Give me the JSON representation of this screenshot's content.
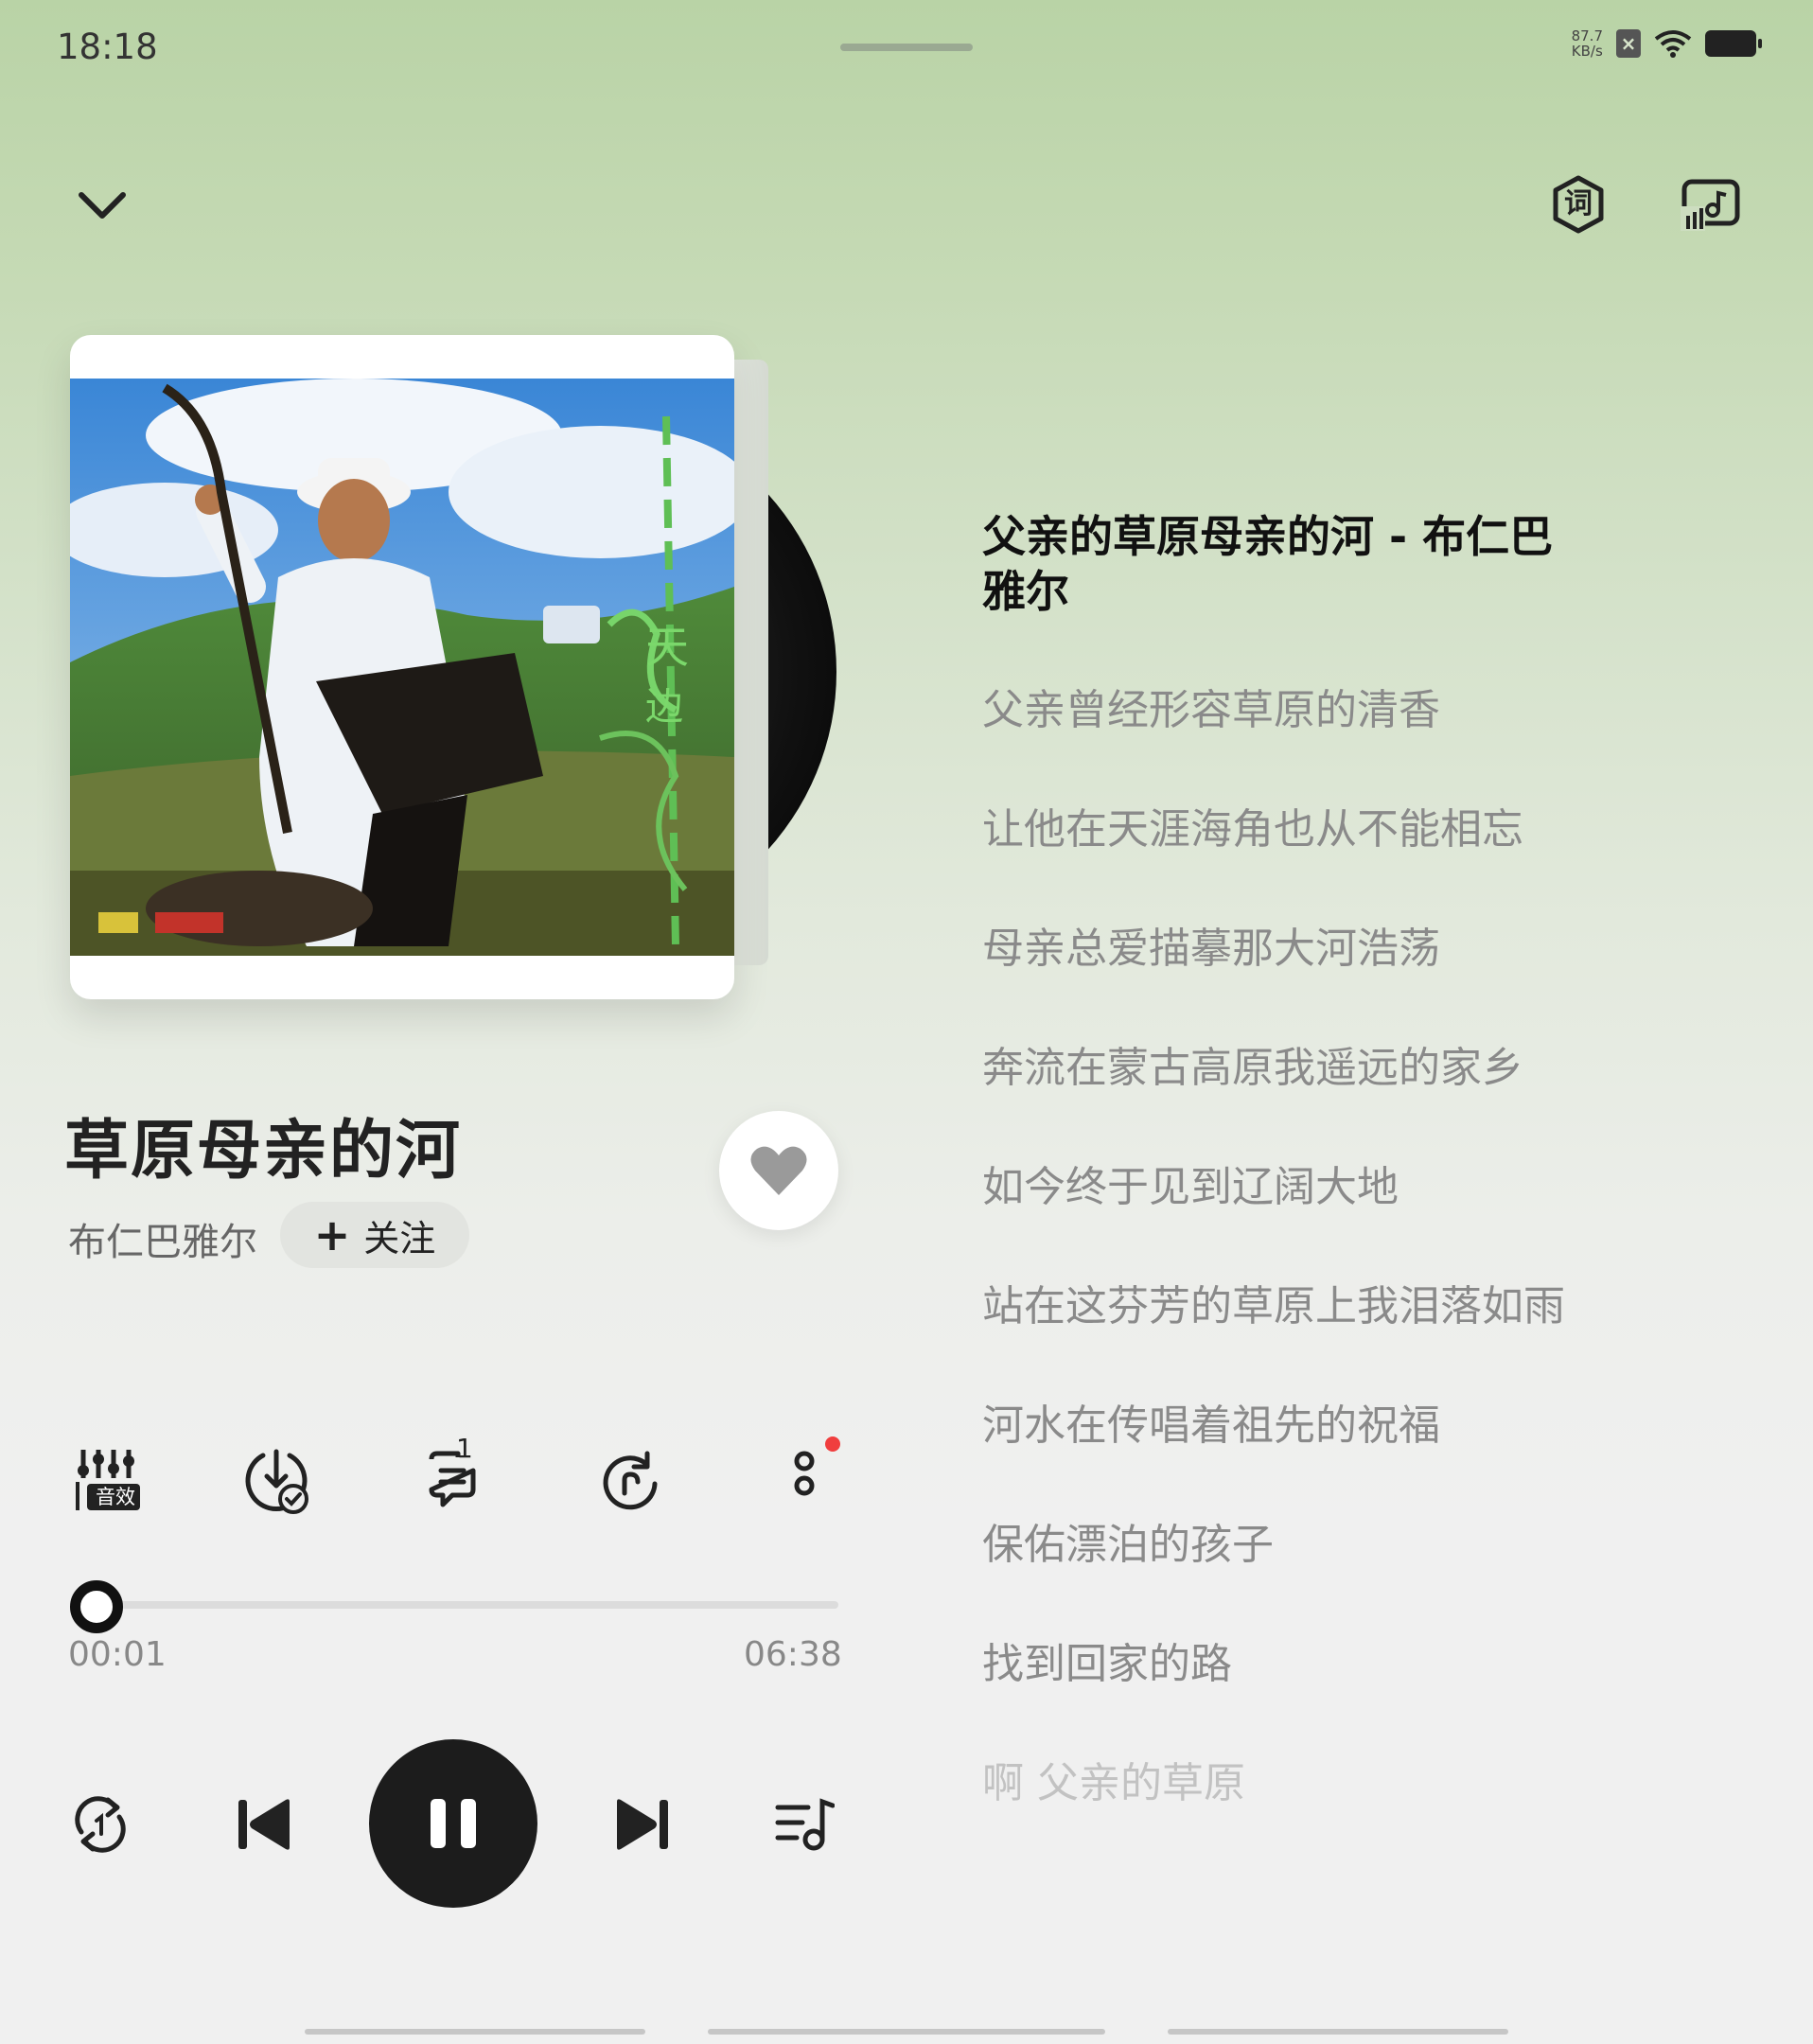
{
  "status_bar": {
    "time": "18:18",
    "net_speed_value": "87.7",
    "net_speed_unit": "KB/s"
  },
  "header": {
    "collapse_icon": "chevron-down-icon",
    "lyrics_icon_label": "词",
    "cast_icon": "cast-music-icon"
  },
  "song": {
    "title": "草原母亲的河",
    "artist": "布仁巴雅尔",
    "follow_label": "关注",
    "follow_plus": "+"
  },
  "actions": {
    "sound_effects_label": "音效",
    "comment_count": "1"
  },
  "progress": {
    "current": "00:01",
    "total": "06:38",
    "fraction": 0.003
  },
  "lyrics": {
    "active_line": "父亲的草原母亲的河  -  布仁巴雅尔",
    "lines": [
      "父亲曾经形容草原的清香",
      "让他在天涯海角也从不能相忘",
      "母亲总爱描摹那大河浩荡",
      "奔流在蒙古高原我遥远的家乡",
      "如今终于见到辽阔大地",
      "站在这芬芳的草原上我泪落如雨",
      "河水在传唱着祖先的祝福",
      "保佑漂泊的孩子",
      "找到回家的路"
    ],
    "faded_line": "啊  父亲的草原"
  },
  "colors": {
    "accent_dark": "#1c1c1c",
    "notification_dot": "#f03e3e",
    "bg_top": "#b9d3a6",
    "bg_bottom": "#f0f0f0"
  }
}
